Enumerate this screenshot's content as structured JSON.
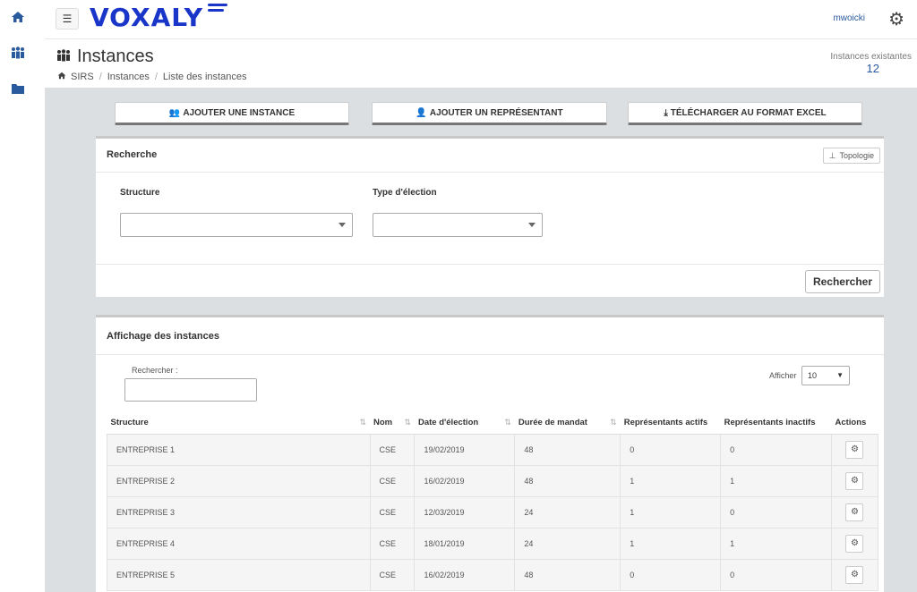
{
  "topbar": {
    "logo": "VOXALY",
    "username": "mwoicki"
  },
  "icons": {
    "rail": [
      "home-icon",
      "users-icon",
      "folder-icon"
    ],
    "settings": "gear-icon"
  },
  "header": {
    "title": "Instances",
    "breadcrumb": [
      "SIRS",
      "Instances",
      "Liste des instances"
    ],
    "count_label": "Instances existantes",
    "count_value": "12"
  },
  "actions": {
    "add_instance": "AJOUTER UNE INSTANCE",
    "add_representative": "AJOUTER UN REPRÉSENTANT",
    "export_excel": "TÉLÉCHARGER AU FORMAT EXCEL"
  },
  "search_panel": {
    "title": "Recherche",
    "topology_button": "Topologie",
    "structure_label": "Structure",
    "structure_value": "",
    "election_type_label": "Type d'élection",
    "election_type_value": "",
    "search_button": "Rechercher"
  },
  "list_panel": {
    "title": "Affichage des instances",
    "search_label": "Rechercher :",
    "search_value": "",
    "show_label": "Afficher",
    "show_value": "10",
    "columns": [
      "Structure",
      "Nom",
      "Date d'élection",
      "Durée de mandat",
      "Représentants actifs",
      "Représentants inactifs",
      "Actions"
    ],
    "rows": [
      {
        "structure": "ENTREPRISE 1",
        "nom": "CSE",
        "date": "19/02/2019",
        "duree": "48",
        "actifs": "0",
        "inactifs": "0"
      },
      {
        "structure": "ENTREPRISE 2",
        "nom": "CSE",
        "date": "16/02/2019",
        "duree": "48",
        "actifs": "1",
        "inactifs": "1"
      },
      {
        "structure": "ENTREPRISE 3",
        "nom": "CSE",
        "date": "12/03/2019",
        "duree": "24",
        "actifs": "1",
        "inactifs": "0"
      },
      {
        "structure": "ENTREPRISE 4",
        "nom": "CSE",
        "date": "18/01/2019",
        "duree": "24",
        "actifs": "1",
        "inactifs": "1"
      },
      {
        "structure": "ENTREPRISE 5",
        "nom": "CSE",
        "date": "16/02/2019",
        "duree": "48",
        "actifs": "0",
        "inactifs": "0"
      }
    ]
  }
}
